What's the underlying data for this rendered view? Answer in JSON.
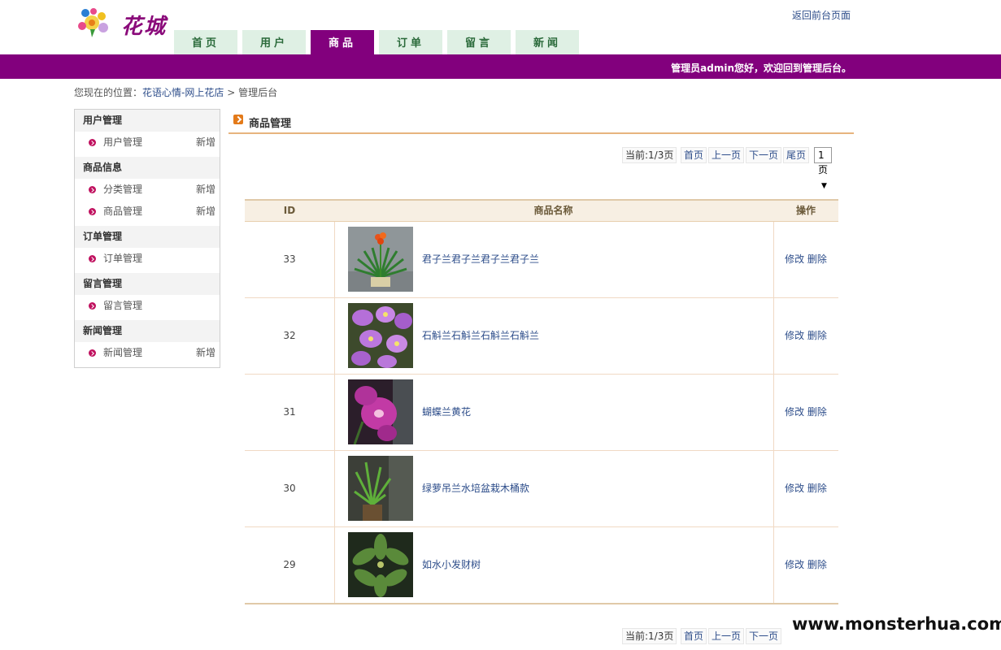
{
  "header": {
    "logo_text": "花城",
    "back_link": "返回前台页面",
    "nav_tabs": [
      "首页",
      "用户",
      "商品",
      "订单",
      "留言",
      "新闻"
    ],
    "active_tab": "商品",
    "welcome": "管理员admin您好，欢迎回到管理后台。"
  },
  "breadcrumb": {
    "prefix": "您现在的位置：",
    "site": "花语心情-网上花店",
    "sep": ">",
    "current": "管理后台"
  },
  "sidebar": {
    "groups": [
      {
        "title": "用户管理",
        "items": [
          {
            "label": "用户管理",
            "add": "新增"
          }
        ]
      },
      {
        "title": "商品信息",
        "items": [
          {
            "label": "分类管理",
            "add": "新增"
          },
          {
            "label": "商品管理",
            "add": "新增"
          }
        ]
      },
      {
        "title": "订单管理",
        "items": [
          {
            "label": "订单管理",
            "add": ""
          }
        ]
      },
      {
        "title": "留言管理",
        "items": [
          {
            "label": "留言管理",
            "add": ""
          }
        ]
      },
      {
        "title": "新闻管理",
        "items": [
          {
            "label": "新闻管理",
            "add": "新增"
          }
        ]
      }
    ]
  },
  "main": {
    "title": "商品管理",
    "pager": {
      "current": "当前:1/3页",
      "first": "首页",
      "prev": "上一页",
      "next": "下一页",
      "last": "尾页",
      "select_value": "1页"
    },
    "table": {
      "headers": {
        "id": "ID",
        "name": "商品名称",
        "ops": "操作"
      },
      "edit_label": "修改",
      "delete_label": "删除",
      "rows": [
        {
          "id": "33",
          "name": "君子兰君子兰君子兰君子兰"
        },
        {
          "id": "32",
          "name": "石斛兰石斛兰石斛兰石斛兰"
        },
        {
          "id": "31",
          "name": "蝴蝶兰黄花"
        },
        {
          "id": "30",
          "name": "绿萝吊兰水培盆栽木桶款"
        },
        {
          "id": "29",
          "name": "如水小发财树"
        }
      ]
    }
  },
  "watermark": "www.monsterhua.com",
  "colors": {
    "brand": "#82007d",
    "tab_bg": "#dff0e4",
    "link": "#2d4d8a",
    "accent_line": "#e7b47e"
  }
}
